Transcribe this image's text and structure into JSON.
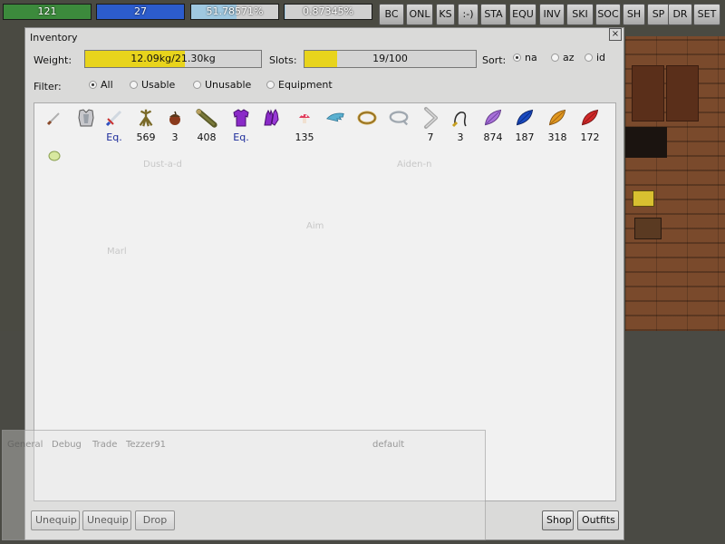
{
  "top_bars": [
    {
      "id": "hp",
      "text": "121",
      "fill": 1.0,
      "color": "#3c8a3c"
    },
    {
      "id": "mp",
      "text": "27",
      "fill": 1.0,
      "color": "#2c5ccc"
    },
    {
      "id": "xp",
      "text": "51.78571%",
      "fill": 0.5178571,
      "color": "#9fc8e0"
    },
    {
      "id": "job",
      "text": "0.87345%",
      "fill": 0.0087345,
      "color": "#9fc8e0"
    }
  ],
  "top_buttons": [
    "BC",
    "ONL",
    "KS",
    ":-)",
    "STA",
    "EQU",
    "INV",
    "SKI",
    "SOC",
    "SH",
    "SP",
    "DR",
    "SET"
  ],
  "inventory": {
    "title": "Inventory",
    "close_label": "×",
    "weight_label": "Weight:",
    "weight_value": "12.09kg/21.30kg",
    "weight_fill": 0.5676,
    "slots_label": "Slots:",
    "slots_value": "19/100",
    "slots_fill": 0.19,
    "sort_label": "Sort:",
    "sort_options": [
      {
        "label": "na",
        "selected": true
      },
      {
        "label": "az",
        "selected": false
      },
      {
        "label": "id",
        "selected": false
      }
    ],
    "filter_label": "Filter:",
    "filter_options": [
      {
        "label": "All",
        "selected": true
      },
      {
        "label": "Usable",
        "selected": false
      },
      {
        "label": "Unusable",
        "selected": false
      },
      {
        "label": "Equipment",
        "selected": false
      }
    ],
    "items": [
      {
        "icon": "knife-icon",
        "count": ""
      },
      {
        "icon": "chest-armor-icon",
        "count": ""
      },
      {
        "icon": "sword-icon",
        "count": "Eq.",
        "equipped": true
      },
      {
        "icon": "root-icon",
        "count": "569"
      },
      {
        "icon": "acorn-icon",
        "count": "3"
      },
      {
        "icon": "log-icon",
        "count": "408"
      },
      {
        "icon": "purple-shirt-icon",
        "count": "Eq.",
        "equipped": true
      },
      {
        "icon": "purple-gloves-icon",
        "count": ""
      },
      {
        "icon": "mushroom-icon",
        "count": "135"
      },
      {
        "icon": "feather-icon",
        "count": ""
      },
      {
        "icon": "ring-icon",
        "count": ""
      },
      {
        "icon": "rope-icon",
        "count": ""
      },
      {
        "icon": "boomerang-icon",
        "count": "7"
      },
      {
        "icon": "whip-icon",
        "count": "3"
      },
      {
        "icon": "violet-leaf-icon",
        "count": "874"
      },
      {
        "icon": "blue-leaf-icon",
        "count": "187"
      },
      {
        "icon": "orange-leaf-icon",
        "count": "318"
      },
      {
        "icon": "red-leaf-icon",
        "count": "172"
      },
      {
        "icon": "egg-icon",
        "count": ""
      }
    ],
    "buttons": {
      "unequip1": "Unequip",
      "unequip2": "Unequip",
      "drop": "Drop",
      "shop": "Shop",
      "outfits": "Outfits"
    }
  },
  "chat": {
    "tabs": [
      "General",
      "Debug",
      "Trade",
      "Tezzer91"
    ],
    "channel": "default"
  },
  "colors": {
    "progress_fill": "#e8d41c",
    "equipped_text": "#1a2a9a"
  }
}
